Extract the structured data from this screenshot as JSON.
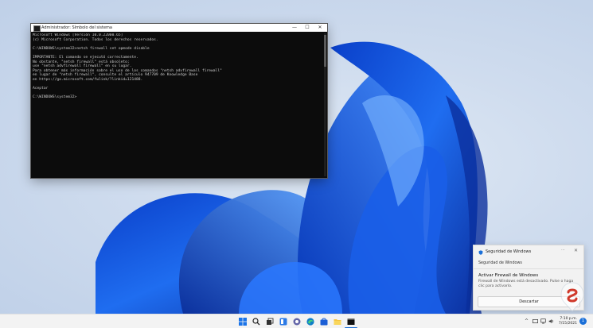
{
  "cmd": {
    "title": "Administrador: Símbolo del sistema",
    "buttons": {
      "minimize": "—",
      "maximize": "☐",
      "close": "✕"
    },
    "lines": [
      "Microsoft Windows [Versión 10.0.22000.65]",
      "(c) Microsoft Corporation. Todos los derechos reservados.",
      "",
      "C:\\WINDOWS\\system32>netsh firewall set opmode disable",
      "",
      "IMPORTANTE: El comando se ejecutó correctamente.",
      "No obstante, \"netsh firewall\" está obsoleto;",
      "use \"netsh advfirewall firewall\" en su lugar.",
      "Para obtener más información sobre el uso de los comandos \"netsh advfirewall firewall\"",
      "en lugar de \"netsh firewall\", consulte el artículo 947709 de Knowledge Base",
      "en https://go.microsoft.com/fwlink/?linkid=121488.",
      "",
      "Aceptar",
      "",
      "C:\\WINDOWS\\system32>"
    ]
  },
  "toast": {
    "app_name": "Seguridad de Windows",
    "more": "···",
    "close": "✕",
    "section": "Seguridad de Windows",
    "title": "Activar Firewall de Windows",
    "body": "Firewall de Windows está desactivado. Pulse o haga clic para activarlo.",
    "button": "Descartar"
  },
  "tray": {
    "chevron": "^",
    "time": "7:10 p.m.",
    "date": "7/15/2021",
    "notifications": "1"
  },
  "taskbar_icons": [
    "windows-start-icon",
    "search-icon",
    "task-view-icon",
    "widgets-icon",
    "chat-icon",
    "edge-icon",
    "microsoft-store-icon",
    "file-explorer-icon",
    "terminal-icon"
  ],
  "colors": {
    "cmd_bg": "#0c0c0c",
    "cmd_text": "#cccccc",
    "accent": "#1a6fd8",
    "taskbar": "#f3f3f3"
  }
}
